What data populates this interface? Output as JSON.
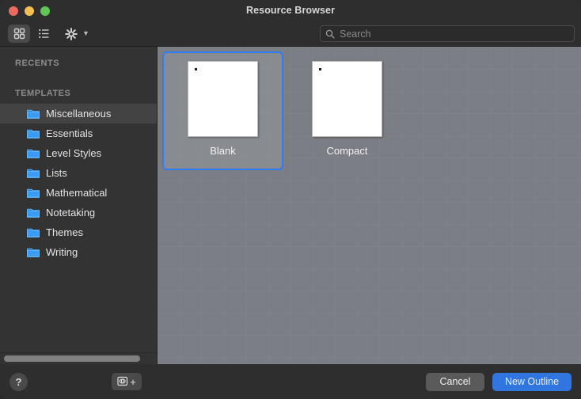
{
  "window": {
    "title": "Resource Browser",
    "traffic_lights": [
      {
        "name": "close",
        "color": "#ed6a5e"
      },
      {
        "name": "minimize",
        "color": "#f5bf4f"
      },
      {
        "name": "zoom",
        "color": "#61c554"
      }
    ]
  },
  "toolbar": {
    "icon_grid_view": "grid-view-icon",
    "icon_list_view": "list-view-icon",
    "icon_action_gear": "gear-icon",
    "icon_chevron": "chevron-down-icon",
    "grid_view_selected": true,
    "search": {
      "icon": "search-icon",
      "value": "",
      "placeholder": "Search"
    }
  },
  "sidebar": {
    "sections": [
      {
        "header": "RECENTS",
        "items": []
      },
      {
        "header": "TEMPLATES",
        "items": [
          {
            "label": "Miscellaneous",
            "icon": "folder-icon",
            "selected": true
          },
          {
            "label": "Essentials",
            "icon": "folder-icon",
            "selected": false
          },
          {
            "label": "Level Styles",
            "icon": "folder-icon",
            "selected": false
          },
          {
            "label": "Lists",
            "icon": "folder-icon",
            "selected": false
          },
          {
            "label": "Mathematical",
            "icon": "folder-icon",
            "selected": false
          },
          {
            "label": "Notetaking",
            "icon": "folder-icon",
            "selected": false
          },
          {
            "label": "Themes",
            "icon": "folder-icon",
            "selected": false
          },
          {
            "label": "Writing",
            "icon": "folder-icon",
            "selected": false
          }
        ]
      }
    ],
    "folder_color": "#3a9bf5"
  },
  "content": {
    "items": [
      {
        "label": "Blank",
        "selected": true
      },
      {
        "label": "Compact",
        "selected": false
      }
    ],
    "selection_color": "#2f7cf6",
    "background_color": "#7b7e84"
  },
  "footer": {
    "help_label": "?",
    "help_icon": "question-mark-icon",
    "add_template_icon": "add-template-icon",
    "add_template_plus": "+",
    "cancel_label": "Cancel",
    "primary_label": "New Outline",
    "primary_color": "#3075e0"
  }
}
